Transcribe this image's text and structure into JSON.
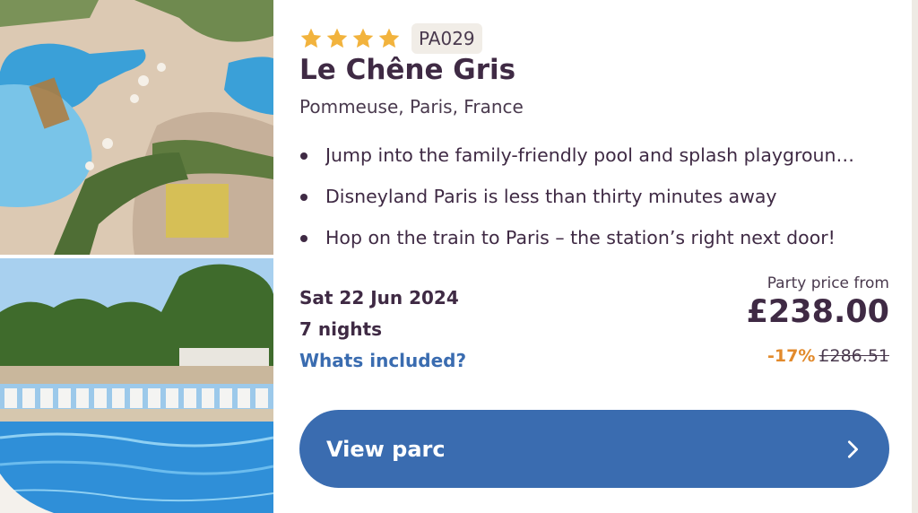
{
  "colors": {
    "accent_blue": "#3a6cb0",
    "star_gold": "#f2b33d",
    "discount_orange": "#e28a2c",
    "text_purple": "#3f2a44"
  },
  "listing": {
    "star_rating": 4,
    "code": "PA029",
    "name": "Le Chêne Gris",
    "location": "Pommeuse, Paris, France",
    "highlights": [
      "Jump into the family-friendly pool and splash playgroun…",
      "Disneyland Paris is less than thirty minutes away",
      "Hop on the train to Paris – the station’s right next door!"
    ],
    "date": "Sat 22 Jun 2024",
    "nights": "7 nights",
    "included_link": "Whats included?"
  },
  "pricing": {
    "label": "Party price from",
    "price": "£238.00",
    "discount": "-17%",
    "was_price": "£286.51"
  },
  "cta": {
    "label": "View parc",
    "icon": "chevron-right-icon"
  }
}
